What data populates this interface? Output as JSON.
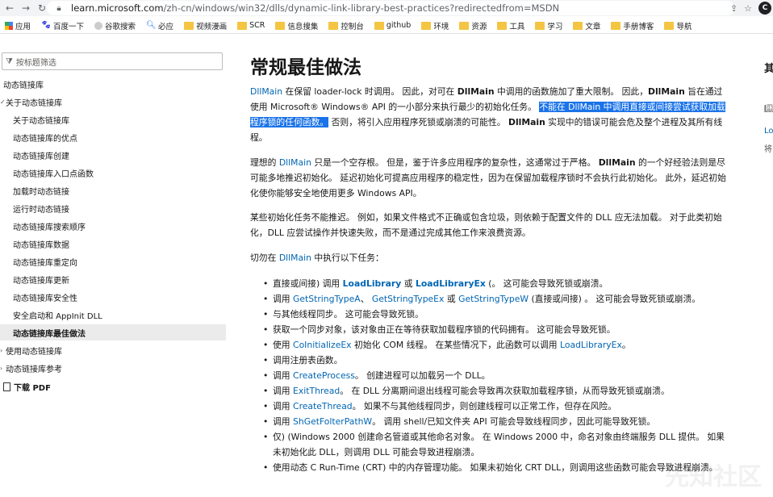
{
  "browser": {
    "url_host": "learn.microsoft.com",
    "url_path": "/zh-cn/windows/win32/dlls/dynamic-link-library-best-practices?redirectedfrom=MSDN",
    "avatar_letter": "C"
  },
  "bookmarks": [
    {
      "label": "应用",
      "icon": "apps"
    },
    {
      "label": "百度一下",
      "icon": "baidu"
    },
    {
      "label": "谷歌搜索",
      "icon": "globe"
    },
    {
      "label": "必应",
      "icon": "search"
    },
    {
      "label": "视频漫画",
      "icon": "folder"
    },
    {
      "label": "SCR",
      "icon": "folder"
    },
    {
      "label": "信息搜集",
      "icon": "folder"
    },
    {
      "label": "控制台",
      "icon": "folder"
    },
    {
      "label": "github",
      "icon": "folder"
    },
    {
      "label": "环境",
      "icon": "folder"
    },
    {
      "label": "资源",
      "icon": "folder"
    },
    {
      "label": "工具",
      "icon": "folder"
    },
    {
      "label": "学习",
      "icon": "folder"
    },
    {
      "label": "文章",
      "icon": "folder"
    },
    {
      "label": "手册博客",
      "icon": "folder"
    },
    {
      "label": "导航",
      "icon": "folder"
    }
  ],
  "sidebar": {
    "filter_placeholder": "按标题筛选",
    "items": [
      {
        "label": "动态链接库",
        "indent": 0,
        "chevron": ""
      },
      {
        "label": "关于动态链接库",
        "indent": 0,
        "chevron": "✓"
      },
      {
        "label": "关于动态链接库",
        "indent": 1,
        "chevron": ""
      },
      {
        "label": "动态链接库的优点",
        "indent": 1,
        "chevron": ""
      },
      {
        "label": "动态链接库创建",
        "indent": 1,
        "chevron": ""
      },
      {
        "label": "动态链接库入口点函数",
        "indent": 1,
        "chevron": ""
      },
      {
        "label": "加载时动态链接",
        "indent": 1,
        "chevron": ""
      },
      {
        "label": "运行时动态链接",
        "indent": 1,
        "chevron": ""
      },
      {
        "label": "动态链接库搜索顺序",
        "indent": 1,
        "chevron": ""
      },
      {
        "label": "动态链接库数据",
        "indent": 1,
        "chevron": ""
      },
      {
        "label": "动态链接库重定向",
        "indent": 1,
        "chevron": ""
      },
      {
        "label": "动态链接库更新",
        "indent": 1,
        "chevron": ""
      },
      {
        "label": "动态链接库安全性",
        "indent": 1,
        "chevron": ""
      },
      {
        "label": "安全启动和 AppInit DLL",
        "indent": 1,
        "chevron": ""
      },
      {
        "label": "动态链接库最佳做法",
        "indent": 1,
        "chevron": "",
        "active": true
      },
      {
        "label": "使用动态链接库",
        "indent": 0,
        "chevron": "›"
      },
      {
        "label": "动态链接库参考",
        "indent": 0,
        "chevron": "›"
      }
    ],
    "download_pdf": "下载 PDF"
  },
  "main": {
    "title": "常规最佳做法",
    "p1": {
      "s1": "DllMain",
      "s2": " 在保留 loader-lock 时调用。 因此，对可在 ",
      "s3": "DllMain",
      "s4": " 中调用的函数施加了重大限制。 因此，",
      "s5": "DllMain",
      "s6": " 旨在通过使用 Microsoft® Windows® API 的一小部分来执行最少的初始化任务。 ",
      "hl": "不能在 DllMain 中调用直接或间接尝试获取加载程序锁的任何函数。",
      "s7": " 否则，将引入应用程序死锁或崩溃的可能性。 ",
      "s8": "DllMain",
      "s9": " 实现中的错误可能会危及整个进程及其所有线程。"
    },
    "p2": {
      "s1": "理想的 ",
      "s2": "DllMain",
      "s3": " 只是一个空存根。 但是，鉴于许多应用程序的复杂性，这通常过于严格。 ",
      "s4": "DllMain",
      "s5": " 的一个好经验法则是尽可能多地推迟初始化。 延迟初始化可提高应用程序的稳定性，因为在保留加载程序锁时不会执行此初始化。 此外，延迟初始化使你能够安全地使用更多 Windows API。"
    },
    "p3": "某些初始化任务不能推迟。 例如，如果文件格式不正确或包含垃圾，则依赖于配置文件的 DLL 应无法加载。 对于此类初始化，DLL 应尝试操作并快速失败，而不是通过完成其他工作来浪费资源。",
    "p4": {
      "s1": "切勿在 ",
      "s2": "DllMain",
      "s3": " 中执行以下任务："
    },
    "tasks": [
      [
        {
          "t": "直接或间接) 调用 "
        },
        {
          "t": "LoadLibrary",
          "c": "bold-link"
        },
        {
          "t": " 或 "
        },
        {
          "t": "LoadLibraryEx",
          "c": "bold-link"
        },
        {
          "t": " (。 这可能会导致死锁或崩溃。"
        }
      ],
      [
        {
          "t": "调用 "
        },
        {
          "t": "GetStringTypeA",
          "c": "link"
        },
        {
          "t": "、 "
        },
        {
          "t": "GetStringTypeEx",
          "c": "link"
        },
        {
          "t": " 或 "
        },
        {
          "t": "GetStringTypeW",
          "c": "link"
        },
        {
          "t": " (直接或间接) 。 这可能会导致死锁或崩溃。"
        }
      ],
      [
        {
          "t": "与其他线程同步。 这可能会导致死锁。"
        }
      ],
      [
        {
          "t": "获取一个同步对象，该对象由正在等待获取加载程序锁的代码拥有。 这可能会导致死锁。"
        }
      ],
      [
        {
          "t": "使用 "
        },
        {
          "t": "CoInitializeEx",
          "c": "link"
        },
        {
          "t": " 初始化 COM 线程。 在某些情况下，此函数可以调用 "
        },
        {
          "t": "LoadLibraryEx",
          "c": "link"
        },
        {
          "t": "。"
        }
      ],
      [
        {
          "t": "调用注册表函数。"
        }
      ],
      [
        {
          "t": "调用 "
        },
        {
          "t": "CreateProcess",
          "c": "link"
        },
        {
          "t": "。 创建进程可以加载另一个 DLL。"
        }
      ],
      [
        {
          "t": "调用 "
        },
        {
          "t": "ExitThread",
          "c": "link"
        },
        {
          "t": "。 在 DLL 分离期间退出线程可能会导致再次获取加载程序锁，从而导致死锁或崩溃。"
        }
      ],
      [
        {
          "t": "调用 "
        },
        {
          "t": "CreateThread",
          "c": "link"
        },
        {
          "t": "。 如果不与其他线程同步，则创建线程可以正常工作，但存在风险。"
        }
      ],
      [
        {
          "t": "调用 "
        },
        {
          "t": "ShGetFolterPathW",
          "c": "link"
        },
        {
          "t": "。 调用 shell/已知文件夹 API 可能会导致线程同步，因此可能导致死锁。"
        }
      ],
      [
        {
          "t": "仅) (Windows 2000 创建命名管道或其他命名对象。 在 Windows 2000 中，命名对象由终端服务 DLL 提供。 如果未初始化此 DLL，则调用 DLL 可能会导致进程崩溃。"
        }
      ],
      [
        {
          "t": "使用动态 C Run-Time (CRT) 中的内存管理功能。 如果未初始化 CRT DLL，则调用这些函数可能会导致进程崩溃。"
        }
      ]
    ]
  },
  "rail": {
    "title": "其",
    "link": "Lo",
    "text": "将"
  },
  "watermark": "先知社区"
}
